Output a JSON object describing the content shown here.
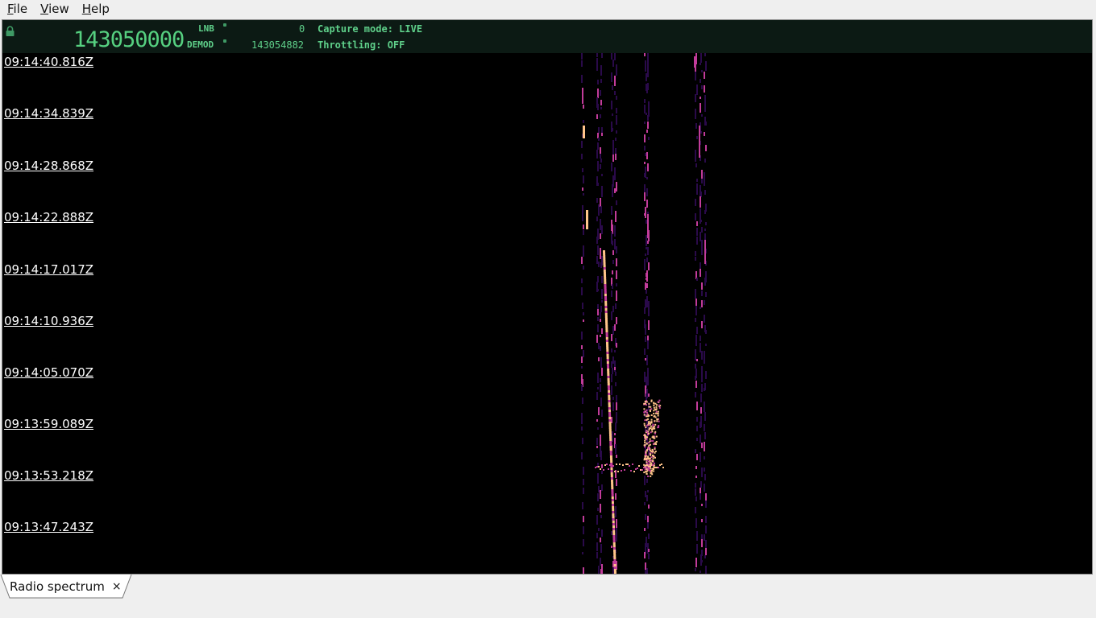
{
  "menu": {
    "file": {
      "first": "F",
      "rest": "ile"
    },
    "view": {
      "first": "V",
      "rest": "iew"
    },
    "help": {
      "first": "H",
      "rest": "elp"
    }
  },
  "header": {
    "main_frequency": "143050000",
    "lnb_label": "LNB",
    "lnb_value": "0",
    "demod_label": "DEMOD",
    "demod_value": "143054882",
    "capture_mode": "Capture mode: LIVE",
    "throttling": "Throttling: OFF",
    "text_color": "#5fd08a"
  },
  "waterfall": {
    "timestamps": [
      "09:14:40.816Z",
      "09:14:34.839Z",
      "09:14:28.868Z",
      "09:14:22.888Z",
      "09:14:17.017Z",
      "09:14:10.936Z",
      "09:14:05.070Z",
      "09:13:59.089Z",
      "09:13:53.218Z",
      "09:13:47.243Z"
    ],
    "palette": {
      "low": "#2a0a4a",
      "mid": "#c23c9a",
      "high": "#ffc48a"
    }
  },
  "tabs": [
    {
      "label": "Radio spectrum",
      "close": "×"
    }
  ],
  "icons": {
    "lock": "lock-icon",
    "close": "close-icon"
  }
}
